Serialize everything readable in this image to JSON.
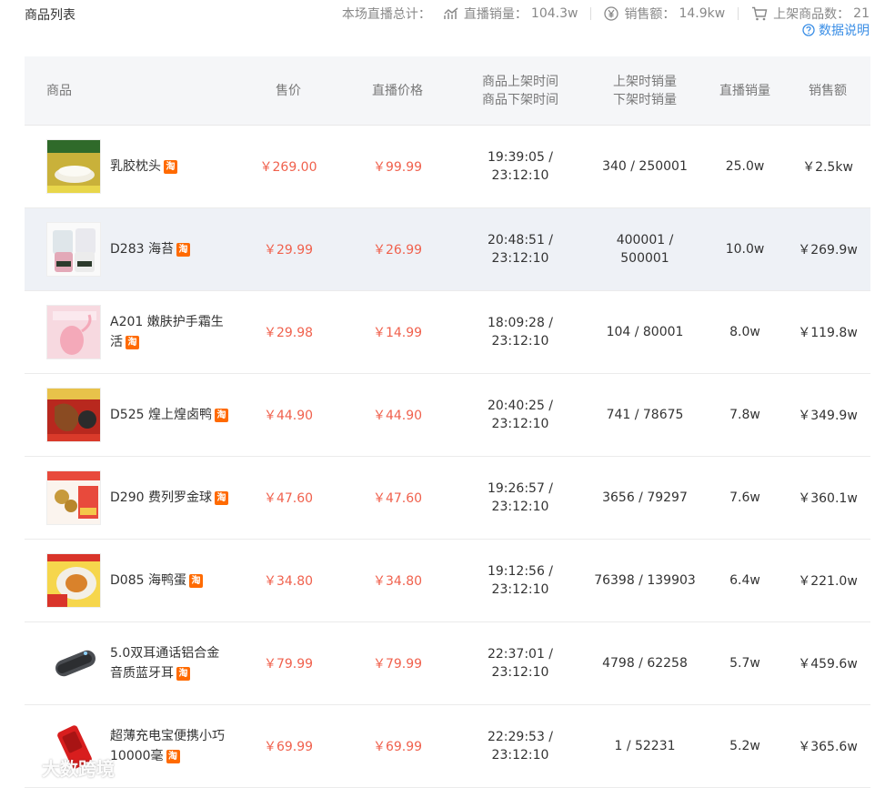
{
  "header": {
    "title": "商品列表",
    "summary_label": "本场直播总计：",
    "live_sales_label": "直播销量：",
    "live_sales_value": "104.3w",
    "revenue_label": "销售额：",
    "revenue_value": "14.9kw",
    "products_label": "上架商品数：",
    "products_value": "21",
    "help_label": "数据说明"
  },
  "table": {
    "columns": {
      "product": "商品",
      "price": "售价",
      "live_price": "直播价格",
      "time_on": "商品上架时间",
      "time_off": "商品下架时间",
      "sales_on": "上架时销量",
      "sales_off": "下架时销量",
      "live_sales": "直播销量",
      "amount": "销售额"
    },
    "rows": [
      {
        "name": "乳胶枕头",
        "price": "￥269.00",
        "live_price": "￥99.99",
        "time_on": "19:39:05 /",
        "time_off": "23:12:10",
        "sales_a": "340 / 250001",
        "sales_b": "",
        "live_sales": "25.0w",
        "amount": "￥2.5kw"
      },
      {
        "name": "D283 海苔",
        "price": "￥29.99",
        "live_price": "￥26.99",
        "time_on": "20:48:51 /",
        "time_off": "23:12:10",
        "sales_a": "400001 /",
        "sales_b": "500001",
        "live_sales": "10.0w",
        "amount": "￥269.9w"
      },
      {
        "name": "A201 嫩肤护手霜生活",
        "price": "￥29.98",
        "live_price": "￥14.99",
        "time_on": "18:09:28 /",
        "time_off": "23:12:10",
        "sales_a": "104 / 80001",
        "sales_b": "",
        "live_sales": "8.0w",
        "amount": "￥119.8w"
      },
      {
        "name": "D525 煌上煌卤鸭",
        "price": "￥44.90",
        "live_price": "￥44.90",
        "time_on": "20:40:25 /",
        "time_off": "23:12:10",
        "sales_a": "741 / 78675",
        "sales_b": "",
        "live_sales": "7.8w",
        "amount": "￥349.9w"
      },
      {
        "name": "D290 费列罗金球",
        "price": "￥47.60",
        "live_price": "￥47.60",
        "time_on": "19:26:57 /",
        "time_off": "23:12:10",
        "sales_a": "3656 / 79297",
        "sales_b": "",
        "live_sales": "7.6w",
        "amount": "￥360.1w"
      },
      {
        "name": "D085 海鸭蛋",
        "price": "￥34.80",
        "live_price": "￥34.80",
        "time_on": "19:12:56 /",
        "time_off": "23:12:10",
        "sales_a": "76398 / 139903",
        "sales_b": "",
        "live_sales": "6.4w",
        "amount": "￥221.0w"
      },
      {
        "name": "5.0双耳通话铝合金音质蓝牙耳",
        "price": "￥79.99",
        "live_price": "￥79.99",
        "time_on": "22:37:01 /",
        "time_off": "23:12:10",
        "sales_a": "4798 / 62258",
        "sales_b": "",
        "live_sales": "5.7w",
        "amount": "￥459.6w"
      },
      {
        "name": "超薄充电宝便携小巧10000毫",
        "price": "￥69.99",
        "live_price": "￥69.99",
        "time_on": "22:29:53 /",
        "time_off": "23:12:10",
        "sales_a": "1 / 52231",
        "sales_b": "",
        "live_sales": "5.2w",
        "amount": "￥365.6w"
      }
    ]
  },
  "badge": "淘",
  "watermark": "大数跨境",
  "colors": {
    "price": "#f0614d",
    "link": "#3a8ee6",
    "header_bg": "#f5f6f8",
    "hover_bg": "#eef1f6",
    "badge": "#ff6a00"
  }
}
